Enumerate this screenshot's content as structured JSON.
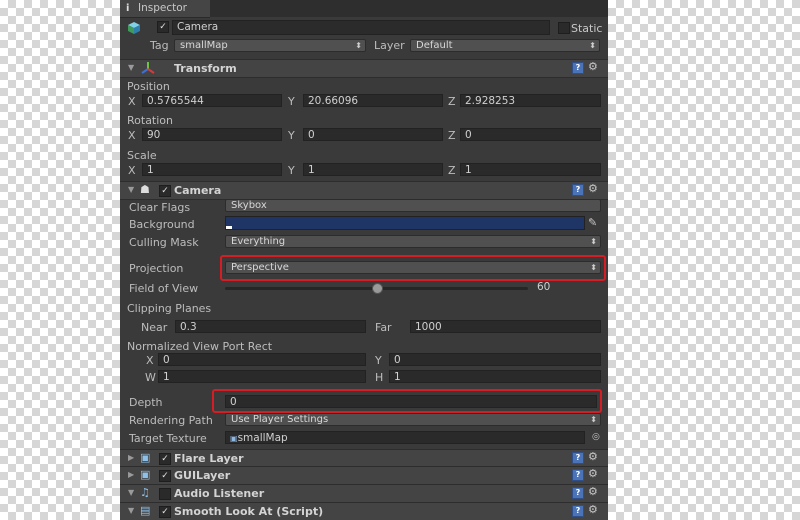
{
  "inspector": {
    "tab_title": "Inspector",
    "info_icon": "i"
  },
  "gameobject": {
    "name": "Camera",
    "static_label": "Static",
    "tag_label": "Tag",
    "tag_value": "smallMap",
    "layer_label": "Layer",
    "layer_value": "Default"
  },
  "transform": {
    "title": "Transform",
    "position_label": "Position",
    "position": {
      "x": "0.5765544",
      "y": "20.66096",
      "z": "2.928253"
    },
    "rotation_label": "Rotation",
    "rotation": {
      "x": "90",
      "y": "0",
      "z": "0"
    },
    "scale_label": "Scale",
    "scale": {
      "x": "1",
      "y": "1",
      "z": "1"
    }
  },
  "axes": {
    "x": "X",
    "y": "Y",
    "z": "Z",
    "w": "W",
    "h": "H"
  },
  "camera": {
    "title": "Camera",
    "clear_flags_label": "Clear Flags",
    "clear_flags_value": "Skybox",
    "background_label": "Background",
    "background_color": "#1f3566",
    "culling_mask_label": "Culling Mask",
    "culling_mask_value": "Everything",
    "projection_label": "Projection",
    "projection_value": "Perspective",
    "fov_label": "Field of View",
    "fov_value": "60",
    "fov_fraction": 0.5,
    "clipping_label": "Clipping Planes",
    "near_label": "Near",
    "near_value": "0.3",
    "far_label": "Far",
    "far_value": "1000",
    "viewport_label": "Normalized View Port Rect",
    "vp_x": "0",
    "vp_y": "0",
    "vp_w": "1",
    "vp_h": "1",
    "depth_label": "Depth",
    "depth_value": "0",
    "rendering_path_label": "Rendering Path",
    "rendering_path_value": "Use Player Settings",
    "target_texture_label": "Target Texture",
    "target_texture_value": "smallMap"
  },
  "components": [
    {
      "name": "Flare Layer",
      "checked": true
    },
    {
      "name": "GUILayer",
      "checked": true
    },
    {
      "name": "Audio Listener",
      "checked": false
    },
    {
      "name": "Smooth Look At (Script)",
      "checked": true
    }
  ],
  "colors": {
    "highlight": "#d41d24",
    "panel": "#3a3a3a"
  }
}
